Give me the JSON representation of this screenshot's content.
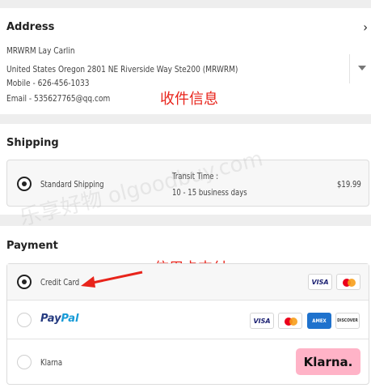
{
  "address": {
    "title": "Address",
    "name": "MRWRM Lay Carlin",
    "street": "United States Oregon 2801 NE Riverside Way Ste200 (MRWRM)",
    "mobile": "Mobile - 626-456-1033",
    "email": "Email - 535627765@qq.com",
    "annotation": "收件信息"
  },
  "shipping": {
    "title": "Shipping",
    "option_label": "Standard Shipping",
    "transit_label": "Transit Time :",
    "transit_value": "10 - 15 business days",
    "price": "$19.99"
  },
  "payment": {
    "title": "Payment",
    "annotation": "信用卡支付",
    "options": [
      {
        "label": "Credit Card",
        "selected": true,
        "cards": [
          "VISA",
          "mastercard"
        ]
      },
      {
        "label": "PayPal",
        "selected": false,
        "cards": [
          "VISA",
          "mastercard",
          "AMEX",
          "DISCOVER"
        ]
      },
      {
        "label": "Klarna",
        "selected": false,
        "badge": "Klarna."
      }
    ]
  },
  "watermark": "乐享好物 olgoodbuy.com",
  "colors": {
    "annotation": "#e8241b",
    "paypal_dark": "#253b80",
    "paypal_light": "#179bd7",
    "klarna_pink": "#ffb3c7"
  }
}
